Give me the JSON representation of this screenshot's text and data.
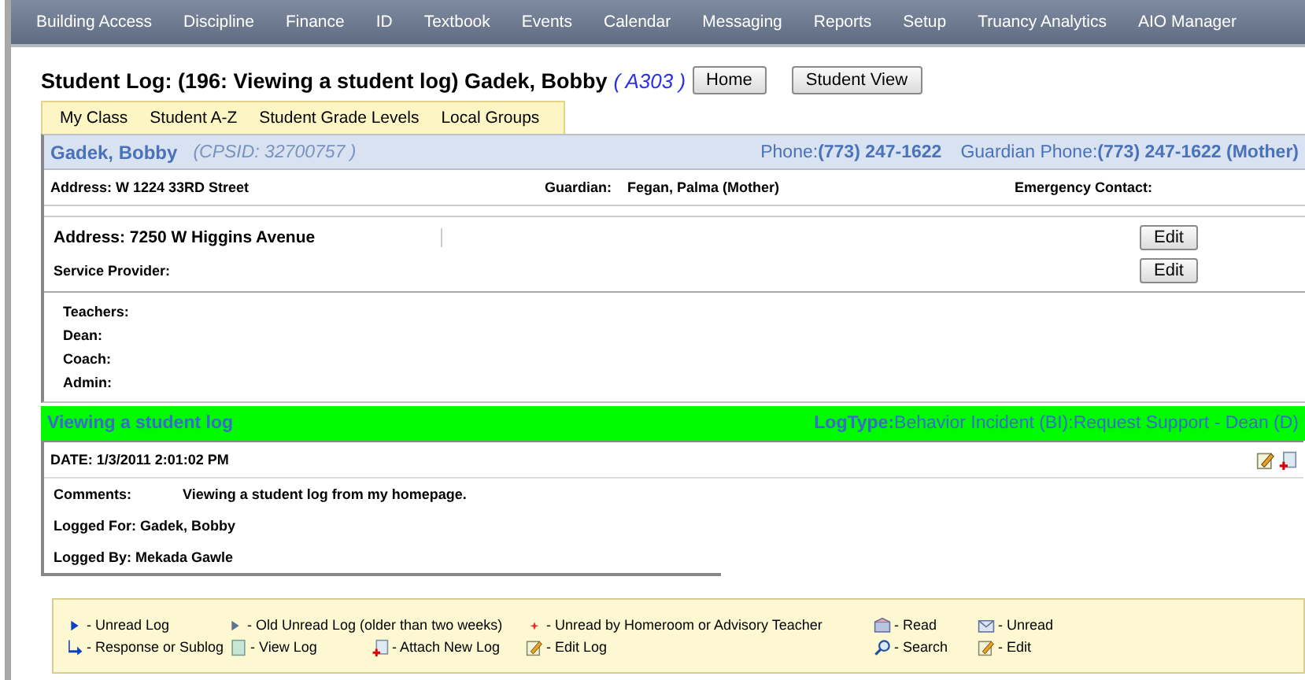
{
  "menu": [
    "Building Access",
    "Discipline",
    "Finance",
    "ID",
    "Textbook",
    "Events",
    "Calendar",
    "Messaging",
    "Reports",
    "Setup",
    "Truancy Analytics",
    "AIO Manager"
  ],
  "title": {
    "text": "Student Log: (196: Viewing a student log) Gadek, Bobby",
    "room": "( A303 )"
  },
  "title_buttons": [
    "Home",
    "Student View"
  ],
  "tabs": [
    "My Class",
    "Student A-Z",
    "Student Grade Levels",
    "Local Groups"
  ],
  "student": {
    "name": "Gadek, Bobby",
    "cpsid": "(CPSID: 32700757 )",
    "phone_label": "Phone:",
    "phone": "(773) 247-1622",
    "guardian_phone_label": "Guardian Phone:",
    "guardian_phone": "(773) 247-1622 (Mother)",
    "address": "Address: W 1224 33RD Street",
    "guardian_label": "Guardian:",
    "guardian": "Fegan, Palma (Mother)",
    "emergency": "Emergency Contact:",
    "address2": "Address: 7250 W Higgins Avenue",
    "service_provider": "Service Provider:",
    "edit_buttons": [
      "Edit",
      "Edit"
    ],
    "staff": [
      "Teachers:",
      "Dean:",
      "Coach:",
      "Admin:"
    ]
  },
  "log": {
    "title": "Viewing a student log",
    "type_label": "LogType:",
    "type": "Behavior Incident (BI):Request Support - Dean (D)",
    "date": "DATE: 1/3/2011 2:01:02 PM",
    "comments_label": "Comments:",
    "comments": "Viewing a student log from my homepage.",
    "logged_for": "Logged For: Gadek, Bobby",
    "logged_by": "Logged By: Mekada Gawle"
  },
  "legend": [
    {
      "kind": "arrow",
      "label": "- Unread Log"
    },
    {
      "kind": "arrow-gray",
      "label": "- Old Unread Log (older than two weeks)"
    },
    {
      "kind": "star",
      "label": "- Unread by Homeroom or Advisory Teacher"
    },
    {
      "kind": "read",
      "label": "- Read"
    },
    {
      "kind": "unread",
      "label": "- Unread"
    },
    {
      "kind": "sublog",
      "label": "- Response or Sublog"
    },
    {
      "kind": "view",
      "label": "- View Log"
    },
    {
      "kind": "attach",
      "label": "- Attach New Log"
    },
    {
      "kind": "edit",
      "label": "- Edit Log"
    },
    {
      "kind": "search",
      "label": "- Search"
    },
    {
      "kind": "edit",
      "label": "- Edit"
    }
  ]
}
